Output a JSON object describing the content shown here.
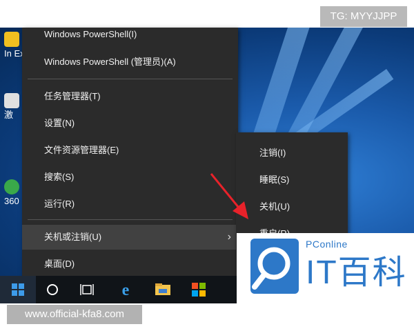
{
  "watermark_top": "TG: MYYJJPP",
  "watermark_bottom": "www.official-kfa8.com",
  "desktop": {
    "icons": [
      {
        "label": "In Ex"
      },
      {
        "label": "激"
      },
      {
        "label": "360"
      }
    ]
  },
  "context_menu": {
    "items": [
      {
        "label": "Windows PowerShell(I)"
      },
      {
        "label": "Windows PowerShell (管理员)(A)"
      },
      {
        "label": "任务管理器(T)"
      },
      {
        "label": "设置(N)"
      },
      {
        "label": "文件资源管理器(E)"
      },
      {
        "label": "搜索(S)"
      },
      {
        "label": "运行(R)"
      },
      {
        "label": "关机或注销(U)",
        "has_submenu": true,
        "highlighted": true
      },
      {
        "label": "桌面(D)"
      }
    ]
  },
  "submenu": {
    "items": [
      {
        "label": "注销(I)"
      },
      {
        "label": "睡眠(S)"
      },
      {
        "label": "关机(U)"
      },
      {
        "label": "重启(R)"
      }
    ]
  },
  "logo": {
    "brand": "PConline",
    "name": "IT百科"
  },
  "taskbar": {
    "icons": [
      "windows-start-icon",
      "cortana-search-icon",
      "task-view-icon",
      "edge-icon",
      "file-explorer-icon",
      "store-icon"
    ]
  },
  "colors": {
    "menu_bg": "#2b2b2b",
    "menu_highlight": "#414141",
    "arrow": "#e8222a",
    "logo_blue": "#2d78c8"
  }
}
